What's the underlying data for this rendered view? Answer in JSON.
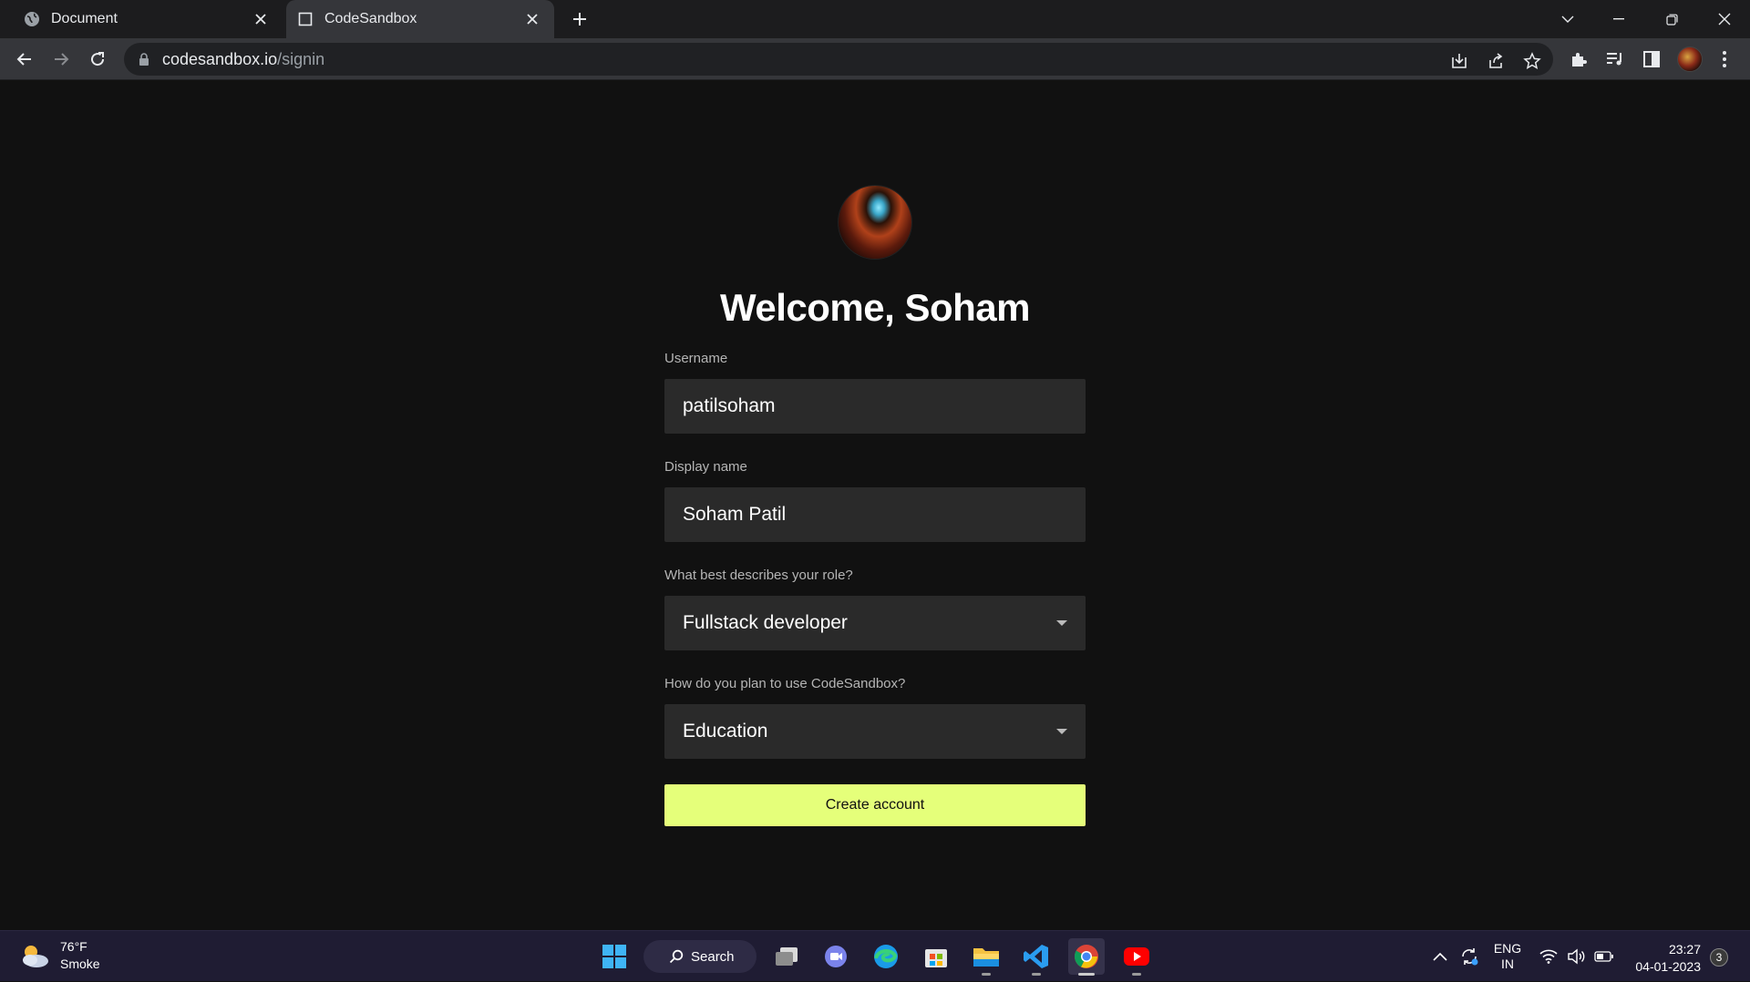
{
  "browser": {
    "tabs": [
      {
        "title": "Document",
        "icon": "globe-icon"
      },
      {
        "title": "CodeSandbox",
        "icon": "square-icon",
        "active": true
      }
    ],
    "url_host": "codesandbox.io",
    "url_path": "/signin"
  },
  "page": {
    "welcome": "Welcome, Soham",
    "fields": {
      "username": {
        "label": "Username",
        "value": "patilsoham"
      },
      "display_name": {
        "label": "Display name",
        "value": "Soham Patil"
      },
      "role": {
        "label": "What best describes your role?",
        "value": "Fullstack developer"
      },
      "usage": {
        "label": "How do you plan to use CodeSandbox?",
        "value": "Education"
      }
    },
    "create_button": "Create account",
    "accent_color": "#e5ff7a"
  },
  "taskbar": {
    "weather_temp": "76°F",
    "weather_desc": "Smoke",
    "search_label": "Search",
    "lang_top": "ENG",
    "lang_bottom": "IN",
    "time": "23:27",
    "date": "04-01-2023",
    "notification_count": "3"
  }
}
